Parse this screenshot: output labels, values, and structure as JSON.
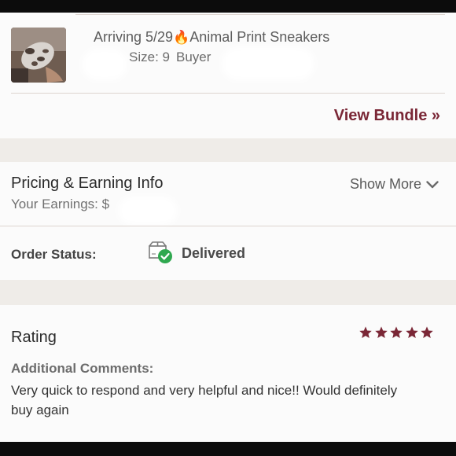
{
  "bundle": {
    "item_title": "Arriving 5/29",
    "item_name": "Animal Print Sneakers",
    "flame_icon": "fire-icon",
    "size_label": "Size: 9",
    "buyer_label": "Buyer",
    "view_bundle_label": "View Bundle »"
  },
  "pricing": {
    "title": "Pricing & Earning Info",
    "earnings_label": "Your Earnings: $",
    "show_more_label": "Show More",
    "chevron_icon": "chevron-down-icon"
  },
  "order": {
    "status_label": "Order Status:",
    "status_icon": "delivered-box-check-icon",
    "status_value": "Delivered",
    "status_color": "#2fa84f"
  },
  "rating": {
    "title": "Rating",
    "stars": 5,
    "max_stars": 5,
    "star_color": "#7a2736",
    "comments_label": "Additional Comments:",
    "comments_text": "Very quick to respond and very helpful and nice!! Would definitely buy again"
  },
  "colors": {
    "accent": "#7a2736",
    "divider_band": "#efece8",
    "card_background": "#fbfbfb"
  }
}
